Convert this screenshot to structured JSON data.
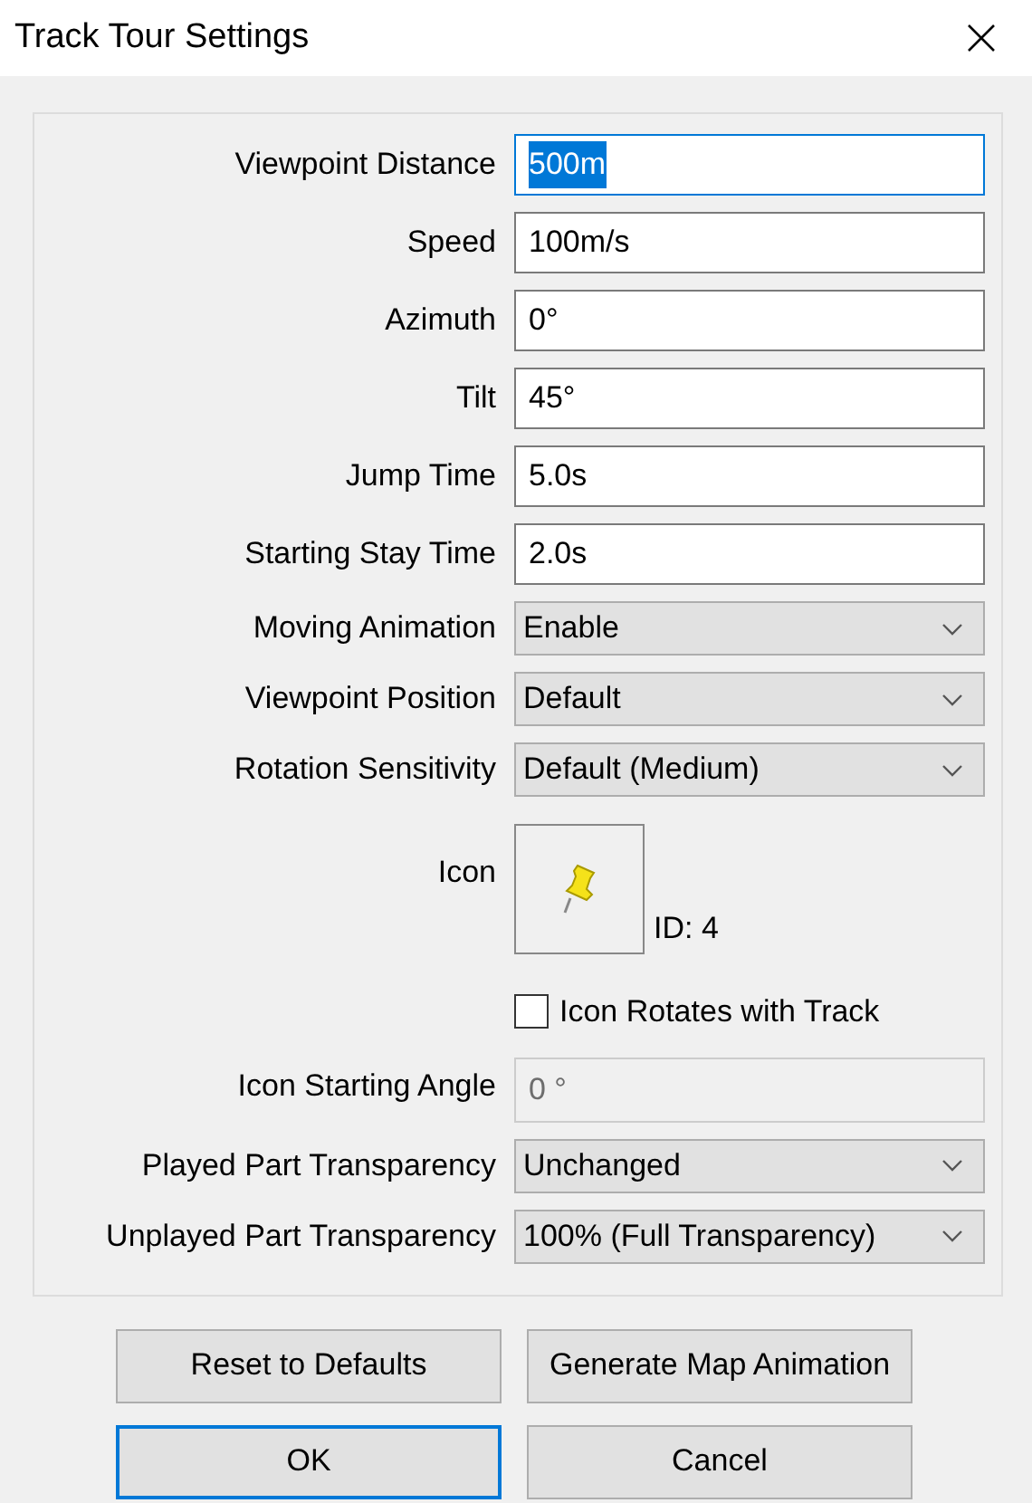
{
  "window": {
    "title": "Track Tour Settings"
  },
  "fields": [
    {
      "kind": "text",
      "label": "Viewpoint Distance",
      "value": "500m",
      "focused": true,
      "disabled": false
    },
    {
      "kind": "text",
      "label": "Speed",
      "value": "100m/s",
      "focused": false,
      "disabled": false
    },
    {
      "kind": "text",
      "label": "Azimuth",
      "value": "0°",
      "focused": false,
      "disabled": false
    },
    {
      "kind": "text",
      "label": "Tilt",
      "value": "45°",
      "focused": false,
      "disabled": false
    },
    {
      "kind": "text",
      "label": "Jump Time",
      "value": "5.0s",
      "focused": false,
      "disabled": false
    },
    {
      "kind": "text",
      "label": "Starting Stay Time",
      "value": "2.0s",
      "focused": false,
      "disabled": false
    },
    {
      "kind": "select",
      "label": "Moving Animation",
      "value": "Enable"
    },
    {
      "kind": "select",
      "label": "Viewpoint Position",
      "value": "Default"
    },
    {
      "kind": "select",
      "label": "Rotation Sensitivity",
      "value": "Default (Medium)"
    },
    {
      "kind": "icon",
      "label": "Icon",
      "id_text": "ID: 4"
    },
    {
      "kind": "checkbox",
      "label": "Icon Rotates with Track",
      "checked": false
    },
    {
      "kind": "text",
      "label": "Icon Starting Angle",
      "value": "0 °",
      "focused": false,
      "disabled": true
    },
    {
      "kind": "select",
      "label": "Played Part Transparency",
      "value": "Unchanged"
    },
    {
      "kind": "select",
      "label": "Unplayed Part Transparency",
      "value": "100% (Full Transparency)"
    }
  ],
  "buttons": [
    {
      "label": "Reset to Defaults",
      "default": false
    },
    {
      "label": "Generate Map Animation",
      "default": false
    },
    {
      "label": "OK",
      "default": true
    },
    {
      "label": "Cancel",
      "default": false
    }
  ]
}
